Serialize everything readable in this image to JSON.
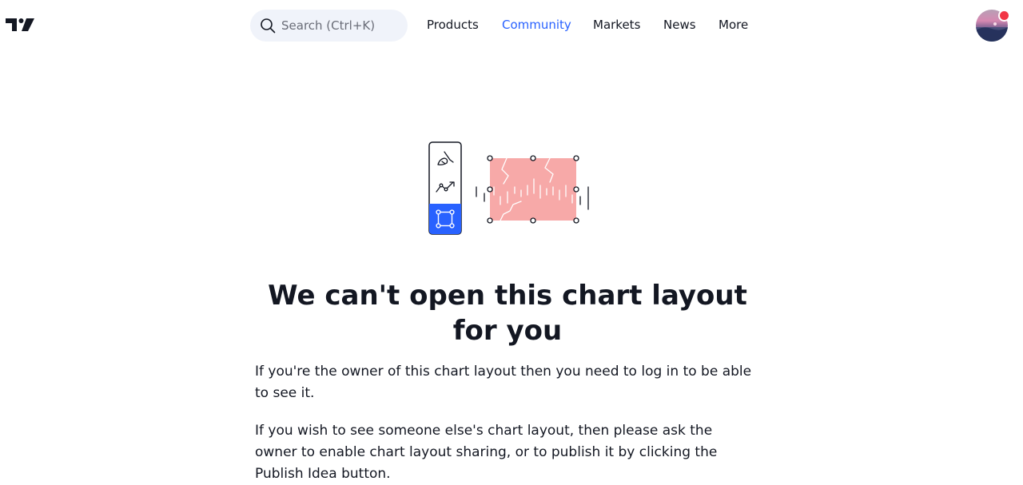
{
  "header": {
    "logo_name": "tradingview-logo",
    "search": {
      "placeholder": "Search (Ctrl+K)",
      "icon": "search-icon"
    },
    "nav": [
      {
        "label": "Products",
        "active": false
      },
      {
        "label": "Community",
        "active": true
      },
      {
        "label": "Markets",
        "active": false
      },
      {
        "label": "News",
        "active": false
      },
      {
        "label": "More",
        "active": false
      }
    ],
    "avatar_icon": "user-avatar",
    "notification_color": "#f23645"
  },
  "illustration": {
    "tool_icons": [
      "brush-icon",
      "trend-line-icon",
      "rectangle-select-icon"
    ],
    "accent_color": "#2962ff",
    "shape_color": "#f7a9a8"
  },
  "main": {
    "title": "We can't open this chart layout for you",
    "paragraph_1": "If you're the owner of this chart layout then you need to log in to be able to see it.",
    "paragraph_2": "If you wish to see someone else's chart layout, then please ask the owner to enable chart layout sharing, or to publish it by clicking the Publish Idea button."
  }
}
